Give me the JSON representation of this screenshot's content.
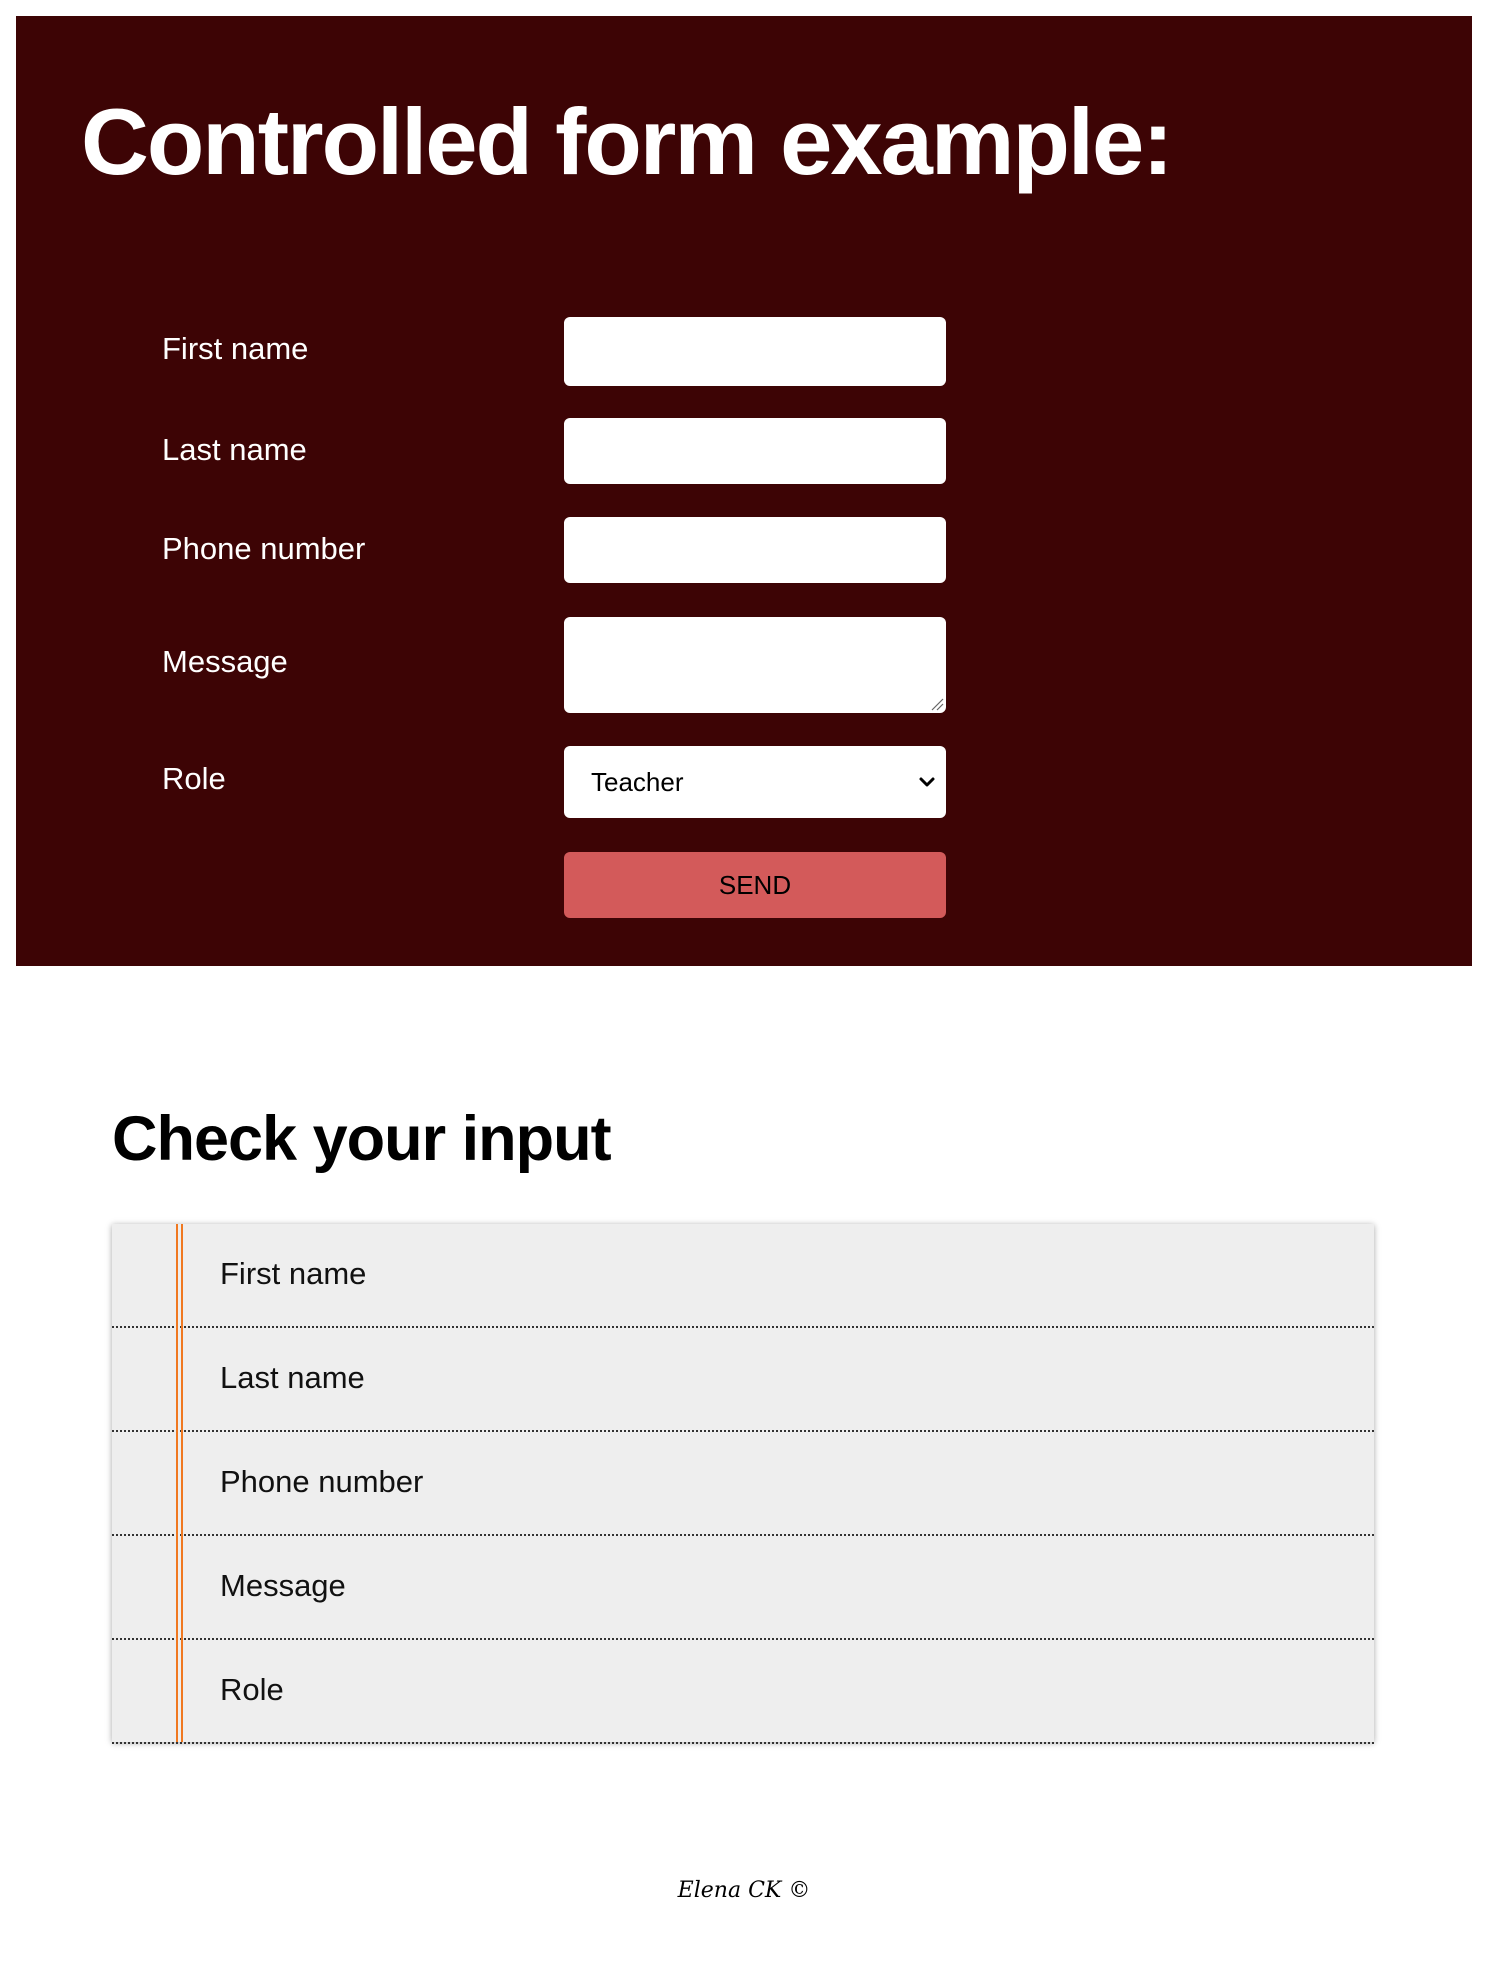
{
  "form": {
    "title": "Controlled form example:",
    "fields": [
      {
        "label": "First name",
        "value": ""
      },
      {
        "label": "Last name",
        "value": ""
      },
      {
        "label": "Phone number",
        "value": ""
      },
      {
        "label": "Message",
        "value": ""
      },
      {
        "label": "Role",
        "selected": "Teacher"
      }
    ],
    "send_label": "SEND"
  },
  "check": {
    "title": "Check your input",
    "rows": [
      "First name",
      "Last name",
      "Phone number",
      "Message",
      "Role"
    ]
  },
  "footer": {
    "signature": "Elena CK ©"
  },
  "colors": {
    "panel_bg": "#3d0405",
    "send_button": "#d35a5a",
    "list_bg": "#eeeeee",
    "margin_line": "#f07820"
  }
}
